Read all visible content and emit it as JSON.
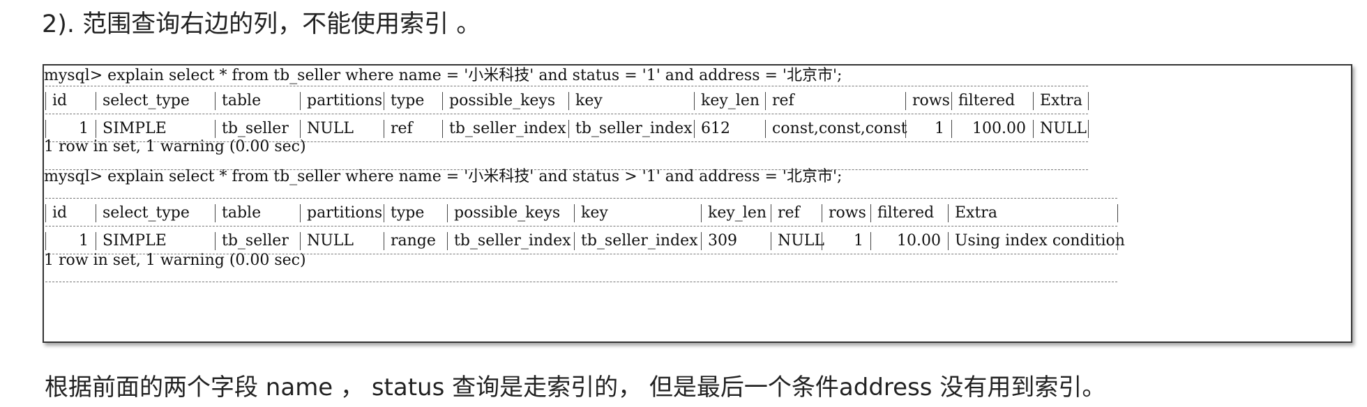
{
  "heading": "2). 范围查询右边的列，不能使用索引 。",
  "query1": {
    "command": "mysql> explain select * from tb_seller where name = '小米科技' and status = '1' and address = '北京市';",
    "headers": [
      "id",
      "select_type",
      "table",
      "partitions",
      "type",
      "possible_keys",
      "key",
      "key_len",
      "ref",
      "rows",
      "filtered",
      "Extra"
    ],
    "row": [
      "1",
      "SIMPLE",
      "tb_seller",
      "NULL",
      "ref",
      "tb_seller_index",
      "tb_seller_index",
      "612",
      "const,const,const",
      "1",
      "100.00",
      "NULL"
    ],
    "summary": "1 row in set, 1 warning (0.00 sec)"
  },
  "query2": {
    "command": "mysql> explain select * from tb_seller where name = '小米科技' and status > '1' and address = '北京市';",
    "headers": [
      "id",
      "select_type",
      "table",
      "partitions",
      "type",
      "possible_keys",
      "key",
      "key_len",
      "ref",
      "rows",
      "filtered",
      "Extra"
    ],
    "row": [
      "1",
      "SIMPLE",
      "tb_seller",
      "NULL",
      "range",
      "tb_seller_index",
      "tb_seller_index",
      "309",
      "NULL",
      "1",
      "10.00",
      "Using index condition"
    ],
    "summary": "1 row in set, 1 warning (0.00 sec)"
  },
  "footer": "根据前面的两个字段 name ， status 查询是走索引的， 但是最后一个条件address 没有用到索引。"
}
